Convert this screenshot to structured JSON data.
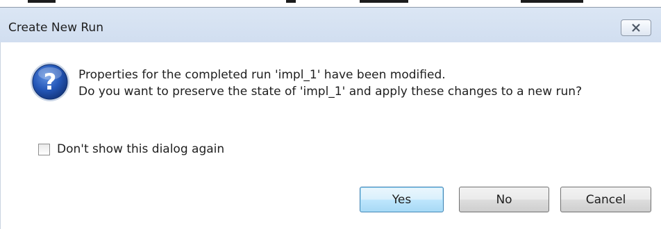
{
  "dialog": {
    "title": "Create New Run",
    "message_line1": "Properties for the completed run 'impl_1' have been modified.",
    "message_line2": "Do you want to preserve the state of 'impl_1' and apply these changes to a new run?",
    "icon": "question-icon",
    "checkbox": {
      "label": "Don't show this dialog again",
      "checked": false
    },
    "buttons": {
      "yes": "Yes",
      "no": "No",
      "cancel": "Cancel"
    },
    "close_icon": "close-icon"
  },
  "colors": {
    "titlebar": "#d6e2f2",
    "icon_blue": "#1f4fa6",
    "default_button_border": "#3c7fb1"
  }
}
